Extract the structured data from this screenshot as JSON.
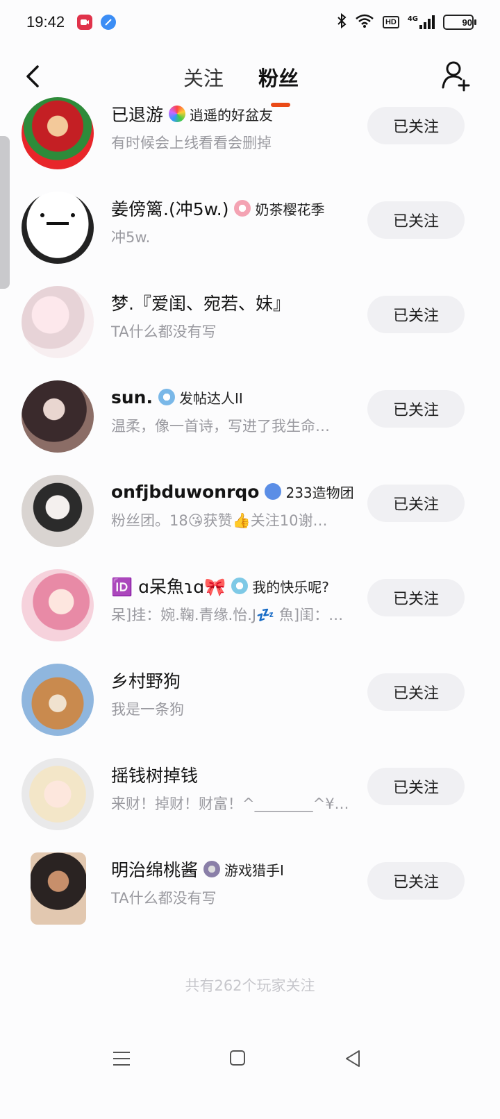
{
  "status_bar": {
    "time": "19:42",
    "network": "4G",
    "hd": "HD",
    "battery": "90"
  },
  "header": {
    "tabs": [
      {
        "label": "关注",
        "active": false
      },
      {
        "label": "粉丝",
        "active": true
      }
    ],
    "accent_color": "#ea4a17"
  },
  "fans": [
    {
      "name": "已退游",
      "badge": "逍遥的好盆友",
      "bio": "有时候会上线看看会删掉",
      "button": "已关注"
    },
    {
      "name": "姜傍篱.(冲5w.)",
      "badge": "奶茶樱花季",
      "bio": "冲5w.",
      "button": "已关注"
    },
    {
      "name": "梦.『爱闺、宛若、妹』",
      "badge": "",
      "bio": "TA什么都没有写",
      "button": "已关注"
    },
    {
      "name": "sun.",
      "badge": "发帖达人II",
      "bio": "温柔，像一首诗，写进了我生命…",
      "button": "已关注"
    },
    {
      "name": "onfjbduwonrqo",
      "badge": "233造物团",
      "bio": "粉丝团。18😘获赞👍关注10谢…",
      "button": "已关注"
    },
    {
      "name": "🆔 ɑ呆魚ɿɑ🎀",
      "badge": "我的快乐呢?",
      "bio": "呆]挂：婉.鞠.青缘.怡.J💤 魚]闺：…",
      "button": "已关注"
    },
    {
      "name": "乡村野狗",
      "badge": "",
      "bio": "我是一条狗",
      "button": "已关注"
    },
    {
      "name": "摇钱树掉钱",
      "badge": "",
      "bio": "来财！掉财！财富！^________^¥…",
      "button": "已关注"
    },
    {
      "name": "明治绵桃酱",
      "badge": "游戏猎手I",
      "bio": "TA什么都没有写",
      "button": "已关注"
    }
  ],
  "footer": {
    "count_text": "共有262个玩家关注"
  }
}
